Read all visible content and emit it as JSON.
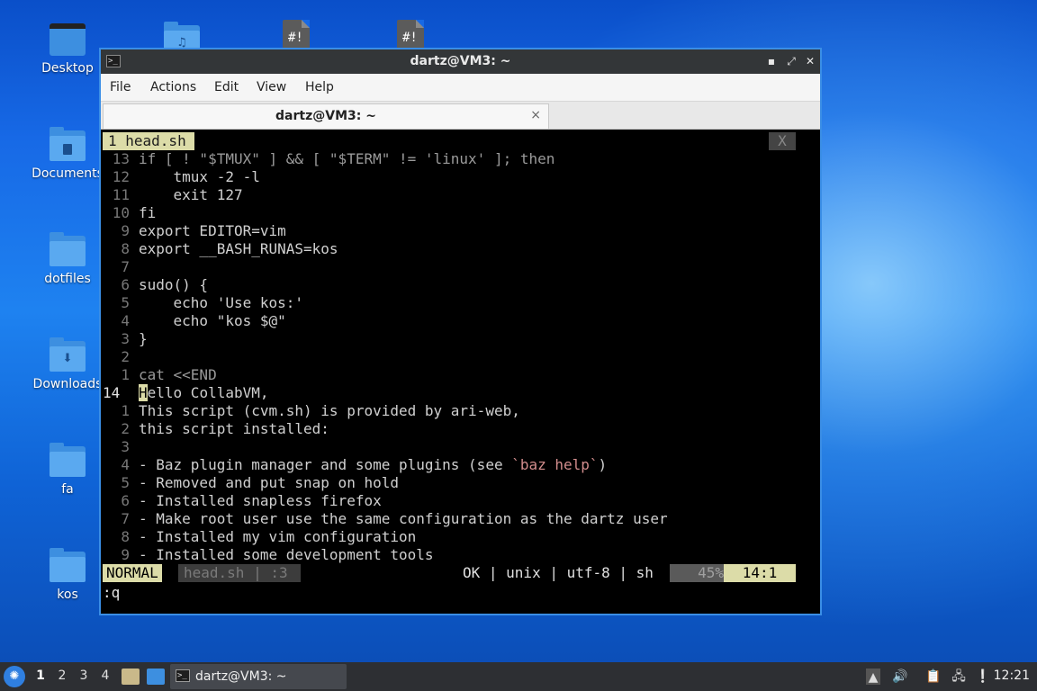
{
  "desktop": {
    "icons": [
      {
        "label": "Desktop",
        "icon": "folder-desktop-icon"
      },
      {
        "label": "Documents",
        "icon": "folder-documents-icon"
      },
      {
        "label": "dotfiles",
        "icon": "folder-icon"
      },
      {
        "label": "Downloads",
        "icon": "folder-downloads-icon"
      },
      {
        "label": "fa",
        "icon": "folder-icon"
      },
      {
        "label": "kos",
        "icon": "folder-icon"
      }
    ],
    "top_icons": [
      {
        "icon": "folder-music-icon"
      },
      {
        "icon": "shell-script-file-icon",
        "glyph": "#!"
      },
      {
        "icon": "shell-script-file-icon",
        "glyph": "#!"
      }
    ]
  },
  "window": {
    "title": "dartz@VM3: ~",
    "menu": [
      "File",
      "Actions",
      "Edit",
      "View",
      "Help"
    ],
    "tab_title": "dartz@VM3: ~",
    "tab_close": "×"
  },
  "vim": {
    "buffer_tab": "1 head.sh",
    "buffer_close": "X",
    "lines": [
      {
        "n": "13",
        "t": "if [ ! \"$TMUX\" ] && [ \"$TERM\" != 'linux' ]; then"
      },
      {
        "n": "12",
        "t": "    tmux -2 -l"
      },
      {
        "n": "11",
        "t": "    exit 127"
      },
      {
        "n": "10",
        "t": "fi"
      },
      {
        "n": "9",
        "t": "export EDITOR=vim"
      },
      {
        "n": "8",
        "t": "export __BASH_RUNAS=kos"
      },
      {
        "n": "7",
        "t": ""
      },
      {
        "n": "6",
        "t": "sudo() {"
      },
      {
        "n": "5",
        "t": "    echo 'Use kos:'"
      },
      {
        "n": "4",
        "t": "    echo \"kos $@\""
      },
      {
        "n": "3",
        "t": "}"
      },
      {
        "n": "2",
        "t": ""
      },
      {
        "n": "1",
        "t": "cat <<END"
      },
      {
        "n": "14",
        "t": "Hello CollabVM,"
      },
      {
        "n": "1",
        "t": "This script (cvm.sh) is provided by ari-web,"
      },
      {
        "n": "2",
        "t": "this script installed:"
      },
      {
        "n": "3",
        "t": ""
      },
      {
        "n": "4",
        "t": "- Baz plugin manager and some plugins (see "
      },
      {
        "n": "5",
        "t": "- Removed and put snap on hold"
      },
      {
        "n": "6",
        "t": "- Installed snapless firefox"
      },
      {
        "n": "7",
        "t": "- Make root user use the same configuration as the dartz user"
      },
      {
        "n": "8",
        "t": "- Installed my vim configuration"
      },
      {
        "n": "9",
        "t": "- Installed some development tools"
      }
    ],
    "baz_help": "`baz help`",
    "baz_close": ")",
    "status": {
      "mode": "NORMAL",
      "file": "head.sh | :3",
      "info": "OK | unix | utf-8 | sh",
      "percent": "45%",
      "position": "14:1"
    },
    "command": ":q"
  },
  "taskbar": {
    "workspaces": [
      "1",
      "2",
      "3",
      "4"
    ],
    "active_workspace": "1",
    "task_label": "dartz@VM3: ~",
    "clock": "12:21"
  }
}
